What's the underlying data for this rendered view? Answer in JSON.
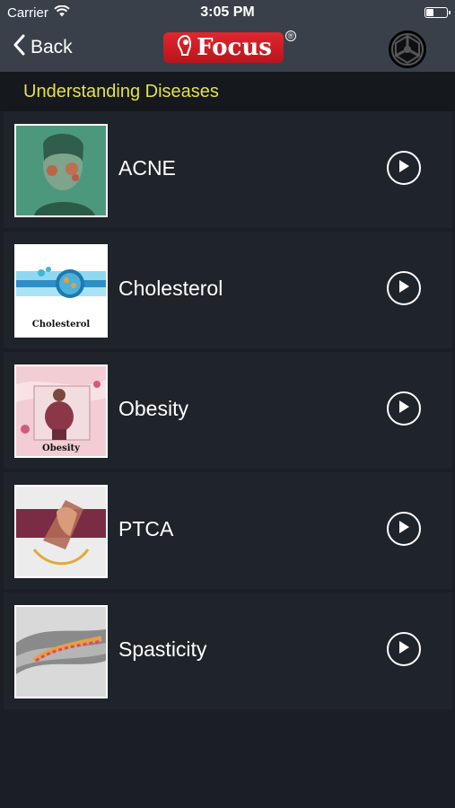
{
  "status": {
    "carrier": "Carrier",
    "time": "3:05 PM"
  },
  "nav": {
    "back_label": "Back",
    "logo_text": "Focus",
    "logo_reg": "®"
  },
  "section": {
    "title": "Understanding Diseases"
  },
  "items": [
    {
      "label": "ACNE"
    },
    {
      "label": "Cholesterol",
      "thumb_caption": "Cholesterol"
    },
    {
      "label": "Obesity",
      "thumb_caption": "Obesity"
    },
    {
      "label": "PTCA"
    },
    {
      "label": "Spasticity"
    }
  ],
  "colors": {
    "header_bg": "#3a4049",
    "page_bg": "#1b1f25",
    "row_bg": "#1f232a",
    "section_title": "#e5e04a",
    "logo_red": "#d31f27"
  }
}
